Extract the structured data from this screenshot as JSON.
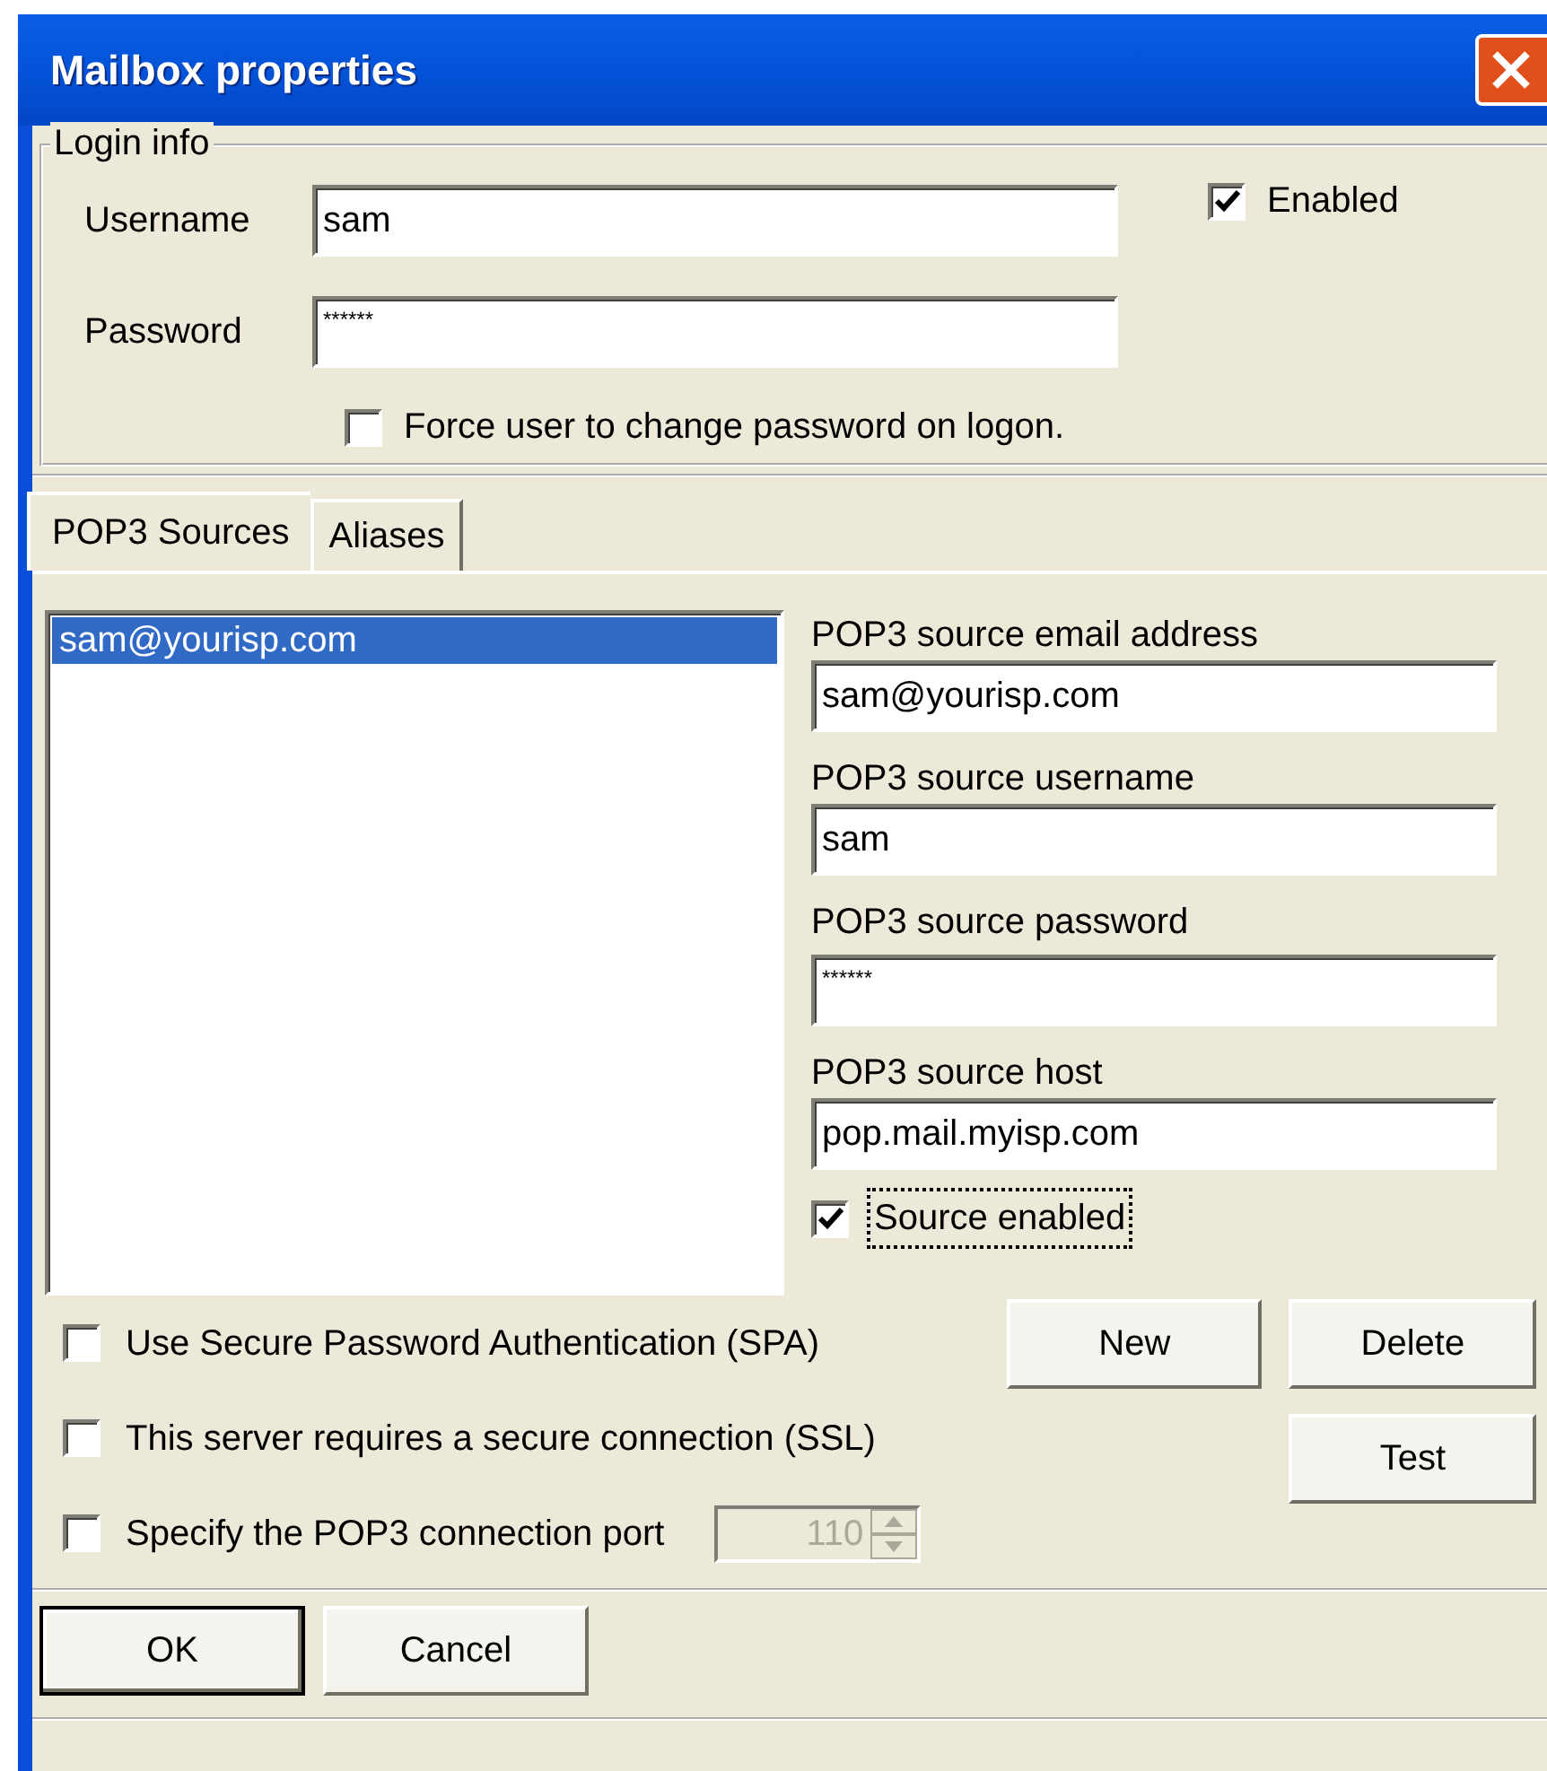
{
  "window": {
    "title": "Mailbox properties"
  },
  "login_info": {
    "legend": "Login info",
    "username": {
      "label": "Username",
      "value": "sam"
    },
    "password": {
      "label": "Password",
      "value": "******"
    },
    "enabled": {
      "label": "Enabled",
      "checked": true
    },
    "force_change": {
      "label": "Force user to change password on logon.",
      "checked": false
    }
  },
  "tabs": [
    {
      "label": "POP3 Sources",
      "selected": true
    },
    {
      "label": "Aliases",
      "selected": false
    }
  ],
  "sources_list": [
    {
      "text": "sam@yourisp.com",
      "selected": true
    }
  ],
  "source_fields": [
    {
      "label": "POP3 source email address",
      "value": "sam@yourisp.com"
    },
    {
      "label": "POP3 source username",
      "value": "sam"
    },
    {
      "label": "POP3 source password",
      "value": "******"
    },
    {
      "label": "POP3 source host",
      "value": "pop.mail.myisp.com"
    }
  ],
  "source_enabled": {
    "label": "Source enabled",
    "checked": true,
    "focused": true
  },
  "source_buttons": [
    "New",
    "Delete",
    "Test"
  ],
  "options": [
    {
      "label": "Use Secure Password Authentication (SPA)",
      "checked": false
    },
    {
      "label": "This server requires a secure connection (SSL)",
      "checked": false
    },
    {
      "label": "Specify the POP3 connection port",
      "checked": false
    }
  ],
  "port": {
    "value": "110",
    "disabled": true
  },
  "dialog_buttons": [
    {
      "label": "OK",
      "default": true
    },
    {
      "label": "Cancel",
      "default": false
    }
  ]
}
